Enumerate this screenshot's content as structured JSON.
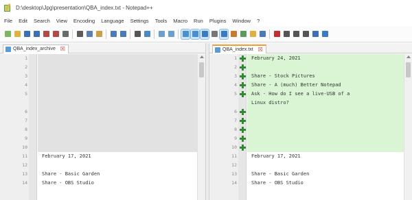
{
  "window": {
    "title": "D:\\desktop\\Jpg\\presentation\\QBA_index.txt - Notepad++"
  },
  "menu": [
    "File",
    "Edit",
    "Search",
    "View",
    "Encoding",
    "Language",
    "Settings",
    "Tools",
    "Macro",
    "Run",
    "Plugins",
    "Window",
    "?"
  ],
  "toolbar": {
    "buttons": [
      {
        "icon": "new-file-icon",
        "color": "#7bb661"
      },
      {
        "icon": "open-folder-icon",
        "color": "#e0b040"
      },
      {
        "icon": "save-icon",
        "color": "#3d6fb6"
      },
      {
        "icon": "save-all-icon",
        "color": "#3d6fb6"
      },
      {
        "icon": "close-icon",
        "color": "#b34a4a"
      },
      {
        "icon": "close-all-icon",
        "color": "#b34a4a"
      },
      {
        "icon": "print-icon",
        "color": "#6a6a6a"
      },
      {
        "sep": true
      },
      {
        "icon": "cut-icon",
        "color": "#5a5a5a"
      },
      {
        "icon": "copy-icon",
        "color": "#5a7fb0"
      },
      {
        "icon": "paste-icon",
        "color": "#c8a04a"
      },
      {
        "sep": true
      },
      {
        "icon": "undo-icon",
        "color": "#4a7ab8"
      },
      {
        "icon": "redo-icon",
        "color": "#4a7ab8"
      },
      {
        "sep": true
      },
      {
        "icon": "find-icon",
        "color": "#555555"
      },
      {
        "icon": "replace-icon",
        "color": "#4a8ac0"
      },
      {
        "sep": true
      },
      {
        "icon": "zoom-in-icon",
        "color": "#6aa0d0"
      },
      {
        "icon": "zoom-out-icon",
        "color": "#6aa0d0"
      },
      {
        "sep": true
      },
      {
        "icon": "sync-vertical-icon",
        "color": "#4a90d0",
        "highlight": true
      },
      {
        "icon": "sync-horizontal-icon",
        "color": "#4a90d0",
        "highlight": true
      },
      {
        "icon": "wrap-icon",
        "color": "#3a7ac0",
        "highlight": true
      },
      {
        "icon": "all-chars-icon",
        "color": "#777777"
      },
      {
        "icon": "indent-guide-icon",
        "color": "#3a7ac0",
        "highlight": true
      },
      {
        "icon": "doc-map-icon",
        "color": "#c87b30"
      },
      {
        "icon": "function-list-icon",
        "color": "#5a9a5a"
      },
      {
        "icon": "folder-workspace-icon",
        "color": "#e0b040"
      },
      {
        "icon": "monitor-icon",
        "color": "#4a7ab8"
      },
      {
        "sep": true
      },
      {
        "icon": "record-macro-icon",
        "color": "#c03030"
      },
      {
        "icon": "stop-record-icon",
        "color": "#555555"
      },
      {
        "icon": "playback-icon",
        "color": "#555555"
      },
      {
        "icon": "run-multiple-icon",
        "color": "#555555"
      },
      {
        "icon": "save-macro-icon",
        "color": "#3d6fb6"
      },
      {
        "icon": "compare-icon",
        "color": "#3a7ac0"
      }
    ]
  },
  "left": {
    "tab": "QBA_index_archive",
    "lines": [
      {
        "n": "1",
        "text": "",
        "bg": "gray"
      },
      {
        "n": "2",
        "text": "",
        "bg": "gray"
      },
      {
        "n": "3",
        "text": "",
        "bg": "gray"
      },
      {
        "n": "4",
        "text": "",
        "bg": "gray"
      },
      {
        "n": "5",
        "text": "",
        "bg": "gray"
      },
      {
        "n": "",
        "text": "",
        "bg": "gray"
      },
      {
        "n": "6",
        "text": "",
        "bg": "gray"
      },
      {
        "n": "7",
        "text": "",
        "bg": "gray"
      },
      {
        "n": "8",
        "text": "",
        "bg": "gray"
      },
      {
        "n": "9",
        "text": "",
        "bg": "gray"
      },
      {
        "n": "10",
        "text": "",
        "bg": "gray"
      },
      {
        "n": "11",
        "text": "February 17, 2021",
        "bg": "none"
      },
      {
        "n": "12",
        "text": "",
        "bg": "none"
      },
      {
        "n": "13",
        "text": "Share - Basic Garden",
        "bg": "none"
      },
      {
        "n": "14",
        "text": "Share - OBS Studio",
        "bg": "none"
      }
    ]
  },
  "right": {
    "tab": "QBA_index.txt",
    "lines": [
      {
        "n": "1",
        "text": "February 24, 2021",
        "bg": "green",
        "plus": true
      },
      {
        "n": "2",
        "text": "",
        "bg": "green",
        "plus": true
      },
      {
        "n": "3",
        "text": "Share - Stock Pictures",
        "bg": "green",
        "plus": true
      },
      {
        "n": "4",
        "text": "Share - A (much) Better Notepad",
        "bg": "green",
        "plus": true
      },
      {
        "n": "5",
        "text": "Ask - How do I see a live-USB of a",
        "bg": "green",
        "plus": true
      },
      {
        "n": "",
        "text": "Linux distro?",
        "bg": "green",
        "plus": false
      },
      {
        "n": "6",
        "text": "",
        "bg": "green",
        "plus": true
      },
      {
        "n": "7",
        "text": "",
        "bg": "green",
        "plus": true
      },
      {
        "n": "8",
        "text": "",
        "bg": "green",
        "plus": true
      },
      {
        "n": "9",
        "text": "",
        "bg": "green",
        "plus": true
      },
      {
        "n": "10",
        "text": "",
        "bg": "green",
        "plus": true
      },
      {
        "n": "11",
        "text": "February 17, 2021",
        "bg": "none",
        "plus": false
      },
      {
        "n": "12",
        "text": "",
        "bg": "none",
        "plus": false
      },
      {
        "n": "13",
        "text": "Share - Basic Garden",
        "bg": "none",
        "plus": false
      },
      {
        "n": "14",
        "text": "Share - OBS Studio",
        "bg": "none",
        "plus": false
      }
    ]
  }
}
